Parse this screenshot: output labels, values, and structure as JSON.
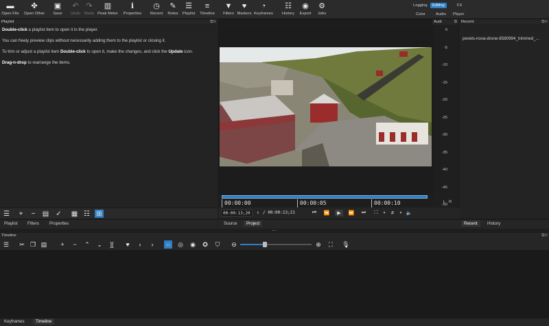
{
  "toolbar": {
    "items": [
      {
        "name": "open-file",
        "label": "Open File",
        "icon": "folder-icon",
        "glyph": "▬",
        "enabled": true
      },
      {
        "name": "open-other",
        "label": "Open Other",
        "icon": "puzzle-icon",
        "glyph": "✤",
        "enabled": true
      },
      {
        "name": "save",
        "label": "Save",
        "icon": "save-icon",
        "glyph": "▣",
        "enabled": true
      },
      {
        "name": "undo",
        "label": "Undo",
        "icon": "undo-icon",
        "glyph": "↶",
        "enabled": false
      },
      {
        "name": "redo",
        "label": "Redo",
        "icon": "redo-icon",
        "glyph": "↷",
        "enabled": false
      },
      {
        "name": "peak-meter",
        "label": "Peak Meter",
        "icon": "meter-icon",
        "glyph": "▥",
        "enabled": true
      },
      {
        "name": "properties",
        "label": "Properties",
        "icon": "info-icon",
        "glyph": "ℹ",
        "enabled": true
      },
      {
        "name": "recent",
        "label": "Recent",
        "icon": "clock-icon",
        "glyph": "◷",
        "enabled": true
      },
      {
        "name": "notes",
        "label": "Notes",
        "icon": "notes-icon",
        "glyph": "✎",
        "enabled": true
      },
      {
        "name": "playlist",
        "label": "Playlist",
        "icon": "playlist-icon",
        "glyph": "☰",
        "enabled": true
      },
      {
        "name": "timeline",
        "label": "Timeline",
        "icon": "timeline-icon",
        "glyph": "≡",
        "enabled": true
      },
      {
        "name": "filters",
        "label": "Filters",
        "icon": "filter-icon",
        "glyph": "▼",
        "enabled": true
      },
      {
        "name": "markers",
        "label": "Markers",
        "icon": "marker-icon",
        "glyph": "♥",
        "enabled": true
      },
      {
        "name": "keyframes",
        "label": "Keyframes",
        "icon": "stopwatch-icon",
        "glyph": "◔",
        "enabled": true
      },
      {
        "name": "history",
        "label": "History",
        "icon": "history-icon",
        "glyph": "☷",
        "enabled": true
      },
      {
        "name": "export",
        "label": "Export",
        "icon": "export-icon",
        "glyph": "◉",
        "enabled": true
      },
      {
        "name": "jobs",
        "label": "Jobs",
        "icon": "gear-icon",
        "glyph": "⚙",
        "enabled": true
      }
    ],
    "layouts": {
      "logging": "Logging",
      "editing": "Editing",
      "fx": "FX",
      "color": "Color",
      "audio": "Audio",
      "player": "Player",
      "active": "Editing"
    }
  },
  "playlist": {
    "title": "Playlist",
    "help": [
      {
        "bold": "Double-click",
        "rest": " a playlist item to open it in the player."
      },
      {
        "text": "You can freely preview clips without necessarily adding them to the playlist or closing it."
      },
      {
        "pre": "To trim or adjust a playlist item ",
        "bold": "Double-click",
        "mid": " to open it, make the changes, and click the ",
        "bold2": "Update",
        "post": " icon."
      },
      {
        "bold": "Drag-n-drop",
        "rest": " to rearrange the items."
      }
    ],
    "tabs": [
      "Playlist",
      "Filters",
      "Properties"
    ]
  },
  "audio": {
    "title": "Audi",
    "scale": [
      "0",
      "-5",
      "-10",
      "-15",
      "-20",
      "-25",
      "-30",
      "-35",
      "-40",
      "-45",
      "-50"
    ],
    "left": "L",
    "right": "R"
  },
  "player": {
    "ruler": [
      "00:00:00",
      "00:00:05",
      "00:00:10"
    ],
    "current_timecode": "00:00:13;20",
    "total_timecode": "/ 00:00:13;21",
    "progress_fraction": 0.99,
    "tabs": [
      "Source",
      "Project"
    ],
    "active_tab": "Project"
  },
  "recent": {
    "title": "Recent",
    "items": [
      "pexels-nova-drone-8580994_trimmed_..."
    ],
    "tabs": [
      "Recent",
      "History"
    ]
  },
  "timeline": {
    "title": "Timeline",
    "zoom_fraction": 0.35,
    "bottom_tabs": [
      "Keyframes",
      "Timeline"
    ]
  },
  "colors": {
    "accent": "#2f7fc4",
    "panel_bg": "#232323",
    "toolbar_bg": "#2b2b2b"
  }
}
